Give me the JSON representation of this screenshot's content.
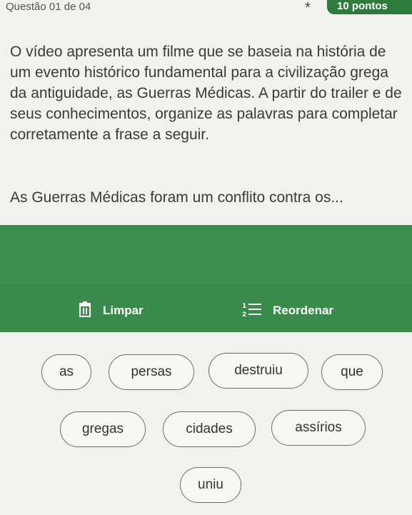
{
  "header": {
    "question_label": "Questão 01 de 04",
    "required_mark": "*",
    "points": "10 pontos"
  },
  "prompt": "O vídeo apresenta um filme que se baseia na história de um evento histórico fundamental para a civilização grega da antiguidade, as Guerras Médicas. A partir do trailer e de seus conhecimentos, organize as palavras para completar corretamente a frase a seguir.",
  "statement": "As Guerras Médicas foram um conflito contra os...",
  "actions": {
    "clear_label": "Limpar",
    "clear_icon": "trash-icon",
    "reorder_label": "Reordenar",
    "reorder_icon": "ordered-list-icon"
  },
  "colors": {
    "accent_green": "#2f7a3d",
    "bar_green": "#3e8e4f"
  },
  "words": [
    "as",
    "persas",
    "destruiu",
    "que",
    "gregas",
    "cidades",
    "assírios",
    "uniu"
  ]
}
